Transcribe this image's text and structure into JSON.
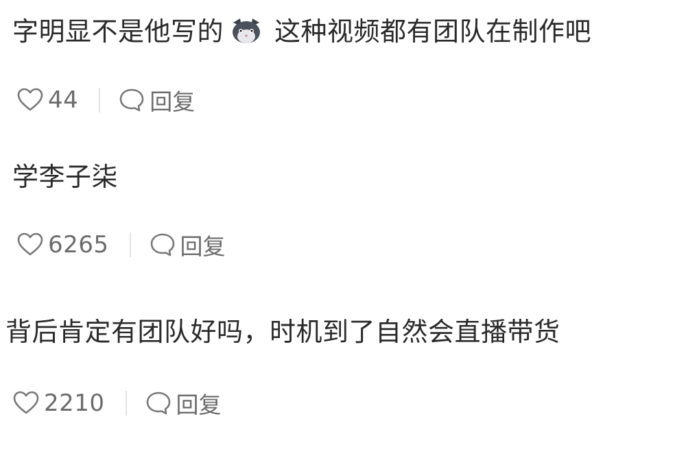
{
  "comments": [
    {
      "text_before": "字明显不是他写的",
      "emoji": "cat-face-emoji",
      "text_after": "这种视频都有团队在制作吧",
      "likes": "44",
      "reply_label": "回复"
    },
    {
      "text": "学李子柒",
      "likes": "6265",
      "reply_label": "回复"
    },
    {
      "text": "背后肯定有团队好吗，时机到了自然会直播带货",
      "likes": "2210",
      "reply_label": "回复"
    }
  ],
  "colors": {
    "text": "#2a2a2a",
    "meta": "#6b6b6b",
    "divider": "#e3e3e3",
    "background": "#ffffff"
  },
  "icons": [
    "heart-icon",
    "reply-icon",
    "cat-face-emoji"
  ]
}
